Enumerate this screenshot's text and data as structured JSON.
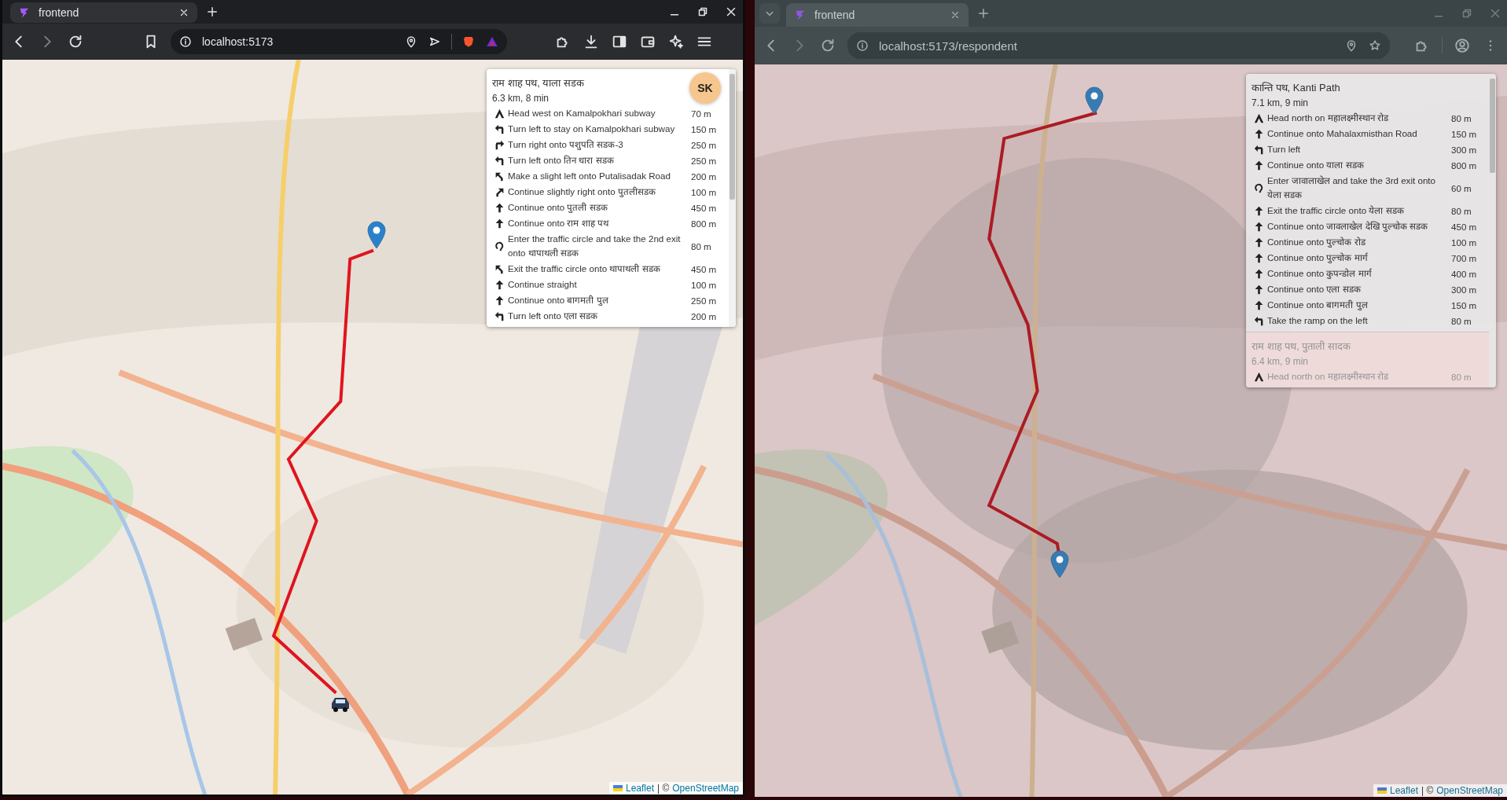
{
  "windows": [
    {
      "kind": "brave",
      "focused": true,
      "tab": {
        "title": "frontend",
        "selected": true
      },
      "url": "localhost:5173",
      "avatar": "SK",
      "panel": {
        "routes": [
          {
            "name": "राम शाह पथ, याला सडक",
            "summary": "6.3 km, 8 min",
            "selected": true,
            "steps": [
              {
                "kind": "depart",
                "text": "Head west on Kamalpokhari subway",
                "distance": "70 m"
              },
              {
                "kind": "left",
                "text": "Turn left to stay on Kamalpokhari subway",
                "distance": "150 m"
              },
              {
                "kind": "right",
                "text": "Turn right onto पशुपति सडक-3",
                "distance": "250 m"
              },
              {
                "kind": "left",
                "text": "Turn left onto तिन धारा सडक",
                "distance": "250 m"
              },
              {
                "kind": "slight-left",
                "text": "Make a slight left onto Putalisadak Road",
                "distance": "200 m"
              },
              {
                "kind": "slight-right",
                "text": "Continue slightly right onto पुतलीसडक",
                "distance": "100 m"
              },
              {
                "kind": "straight",
                "text": "Continue onto पुतली सडक",
                "distance": "450 m"
              },
              {
                "kind": "straight",
                "text": "Continue onto राम शाह पथ",
                "distance": "800 m"
              },
              {
                "kind": "roundabout",
                "text": "Enter the traffic circle and take the 2nd exit onto थापाथली सडक",
                "distance": "80 m"
              },
              {
                "kind": "slight-left",
                "text": "Exit the traffic circle onto थापाथली सडक",
                "distance": "450 m"
              },
              {
                "kind": "straight",
                "text": "Continue straight",
                "distance": "100 m"
              },
              {
                "kind": "straight",
                "text": "Continue onto बागमती पुल",
                "distance": "250 m"
              },
              {
                "kind": "left",
                "text": "Turn left onto एला सडक",
                "distance": "200 m"
              }
            ]
          }
        ]
      },
      "attribution": {
        "leaflet": "Leaflet",
        "separator": "| ©",
        "osm": "OpenStreetMap"
      }
    },
    {
      "kind": "chrome",
      "focused": false,
      "tab": {
        "title": "frontend",
        "selected": true
      },
      "url": "localhost:5173/respondent",
      "panel": {
        "routes": [
          {
            "name": "कान्ति पथ, Kanti Path",
            "summary": "7.1 km, 9 min",
            "selected": true,
            "steps": [
              {
                "kind": "depart",
                "text": "Head north on महालक्ष्मीस्थान रोड",
                "distance": "80 m"
              },
              {
                "kind": "straight",
                "text": "Continue onto Mahalaxmisthan Road",
                "distance": "150 m"
              },
              {
                "kind": "left",
                "text": "Turn left",
                "distance": "300 m"
              },
              {
                "kind": "straight",
                "text": "Continue onto याला सडक",
                "distance": "800 m"
              },
              {
                "kind": "roundabout",
                "text": "Enter जावालाखेल and take the 3rd exit onto येला सडक",
                "distance": "60 m"
              },
              {
                "kind": "straight",
                "text": "Exit the traffic circle onto येला सडक",
                "distance": "80 m"
              },
              {
                "kind": "straight",
                "text": "Continue onto जावलाखेल देखि पुल्चोक सडक",
                "distance": "450 m"
              },
              {
                "kind": "straight",
                "text": "Continue onto पुल्चोक रोड",
                "distance": "100 m"
              },
              {
                "kind": "straight",
                "text": "Continue onto पुल्चोक मार्ग",
                "distance": "700 m"
              },
              {
                "kind": "straight",
                "text": "Continue onto कुपन्डोल मार्ग",
                "distance": "400 m"
              },
              {
                "kind": "straight",
                "text": "Continue onto एला सडक",
                "distance": "300 m"
              },
              {
                "kind": "straight",
                "text": "Continue onto बागमती पुल",
                "distance": "150 m"
              },
              {
                "kind": "left",
                "text": "Take the ramp on the left",
                "distance": "80 m"
              }
            ]
          },
          {
            "name": "राम शाह पथ, पुताली सादक",
            "summary": "6.4 km, 9 min",
            "selected": false,
            "steps": [
              {
                "kind": "depart",
                "text": "Head north on महालक्ष्मीस्थान रोड",
                "distance": "80 m"
              }
            ]
          }
        ]
      },
      "attribution": {
        "leaflet": "Leaflet",
        "separator": "| ©",
        "osm": "OpenStreetMap"
      }
    }
  ]
}
